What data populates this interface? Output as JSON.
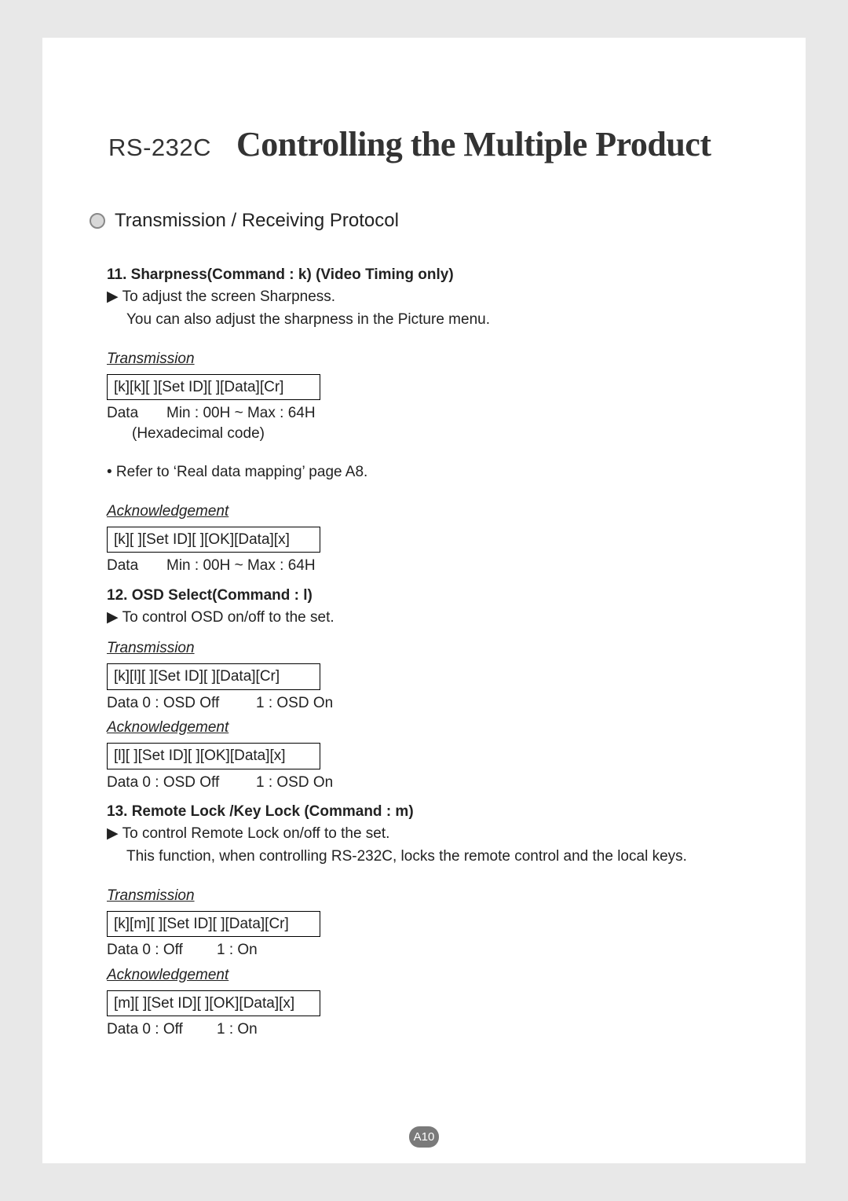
{
  "header": {
    "subtitle": "RS-232C",
    "title": "Controlling the Multiple Product"
  },
  "section": {
    "title": "Transmission / Receiving Protocol"
  },
  "cmd11": {
    "title": "11. Sharpness(Command : k) (Video Timing only)",
    "desc1": "To adjust the screen Sharpness.",
    "desc2": "You can also adjust the sharpness in the Picture menu.",
    "trans": {
      "label": "Transmission",
      "box": "[k][k][ ][Set ID][ ][Data][Cr]",
      "data_label": "Data",
      "data_val": "Min : 00H ~ Max : 64H",
      "data_note": "(Hexadecimal code)"
    },
    "refer": "• Refer to ‘Real data mapping’ page A8.",
    "ack": {
      "label": "Acknowledgement",
      "box": "[k][ ][Set ID][ ][OK][Data][x]",
      "data_label": "Data",
      "data_val": "Min : 00H ~ Max : 64H"
    }
  },
  "cmd12": {
    "title": "12. OSD Select(Command : l)",
    "desc1": "To control OSD on/off to the set.",
    "trans": {
      "label": "Transmission",
      "box": "[k][l][ ][Set ID][ ][Data][Cr]",
      "data_col1": "Data 0 : OSD Off",
      "data_col2": "1 : OSD On"
    },
    "ack": {
      "label": "Acknowledgement",
      "box": "[l][ ][Set ID][ ][OK][Data][x]",
      "data_col1": "Data 0 : OSD Off",
      "data_col2": "1 : OSD On"
    }
  },
  "cmd13": {
    "title": "13. Remote Lock /Key Lock (Command : m)",
    "desc1": "To control Remote Lock on/off to the set.",
    "desc2": "This function, when controlling RS-232C, locks the remote control and the local keys.",
    "trans": {
      "label": "Transmission",
      "box": "[k][m][ ][Set ID][ ][Data][Cr]",
      "data_col1": "Data 0 : Off",
      "data_col2": "1 : On"
    },
    "ack": {
      "label": "Acknowledgement",
      "box": "[m][ ][Set ID][ ][OK][Data][x]",
      "data_col1": "Data 0 : Off",
      "data_col2": "1 : On"
    }
  },
  "page_num": "A10",
  "glyph": {
    "triangle": "▶"
  }
}
